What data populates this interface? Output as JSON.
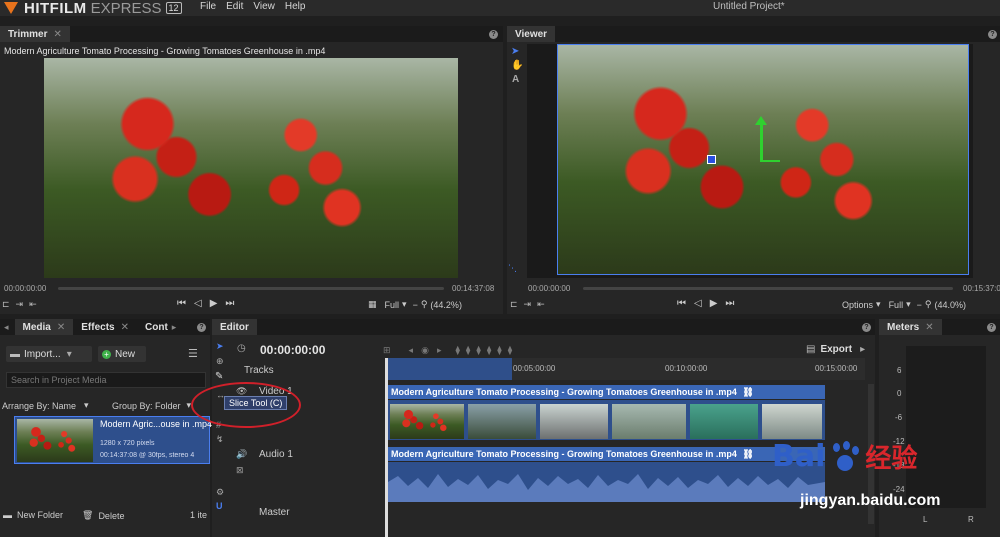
{
  "app": {
    "name_bold": "HITFILM",
    "name_light": "EXPRESS",
    "version": "12",
    "menus": [
      "File",
      "Edit",
      "View",
      "Help"
    ],
    "project_title": "Untitled Project*"
  },
  "trimmer": {
    "tab": "Trimmer",
    "clip_title": "Modern Agriculture Tomato Processing - Growing Tomatoes Greenhouse in .mp4",
    "time_start": "00:00:00:00",
    "time_end": "00:14:37:08",
    "quality": "Full",
    "zoom": "(44.2%)"
  },
  "viewer": {
    "tab": "Viewer",
    "time_start": "00:00:00:00",
    "time_end": "00:15:37:08",
    "options": "Options",
    "quality": "Full",
    "zoom": "(44.0%)"
  },
  "media": {
    "tabs": [
      "Media",
      "Effects",
      "Cont"
    ],
    "import_label": "Import...",
    "new_label": "New",
    "search_placeholder": "Search in Project Media",
    "arrange_label": "Arrange By: Name",
    "group_label": "Group By: Folder",
    "item_name": "Modern Agric...ouse in .mp4",
    "item_res": "1280 x 720 pixels",
    "item_meta": "00:14:37:08 @ 30fps, stereo 4",
    "new_folder": "New Folder",
    "delete": "Delete",
    "count": "1 ite"
  },
  "editor": {
    "tab": "Editor",
    "timecode": "00:00:00:00",
    "export": "Export",
    "tracks_label": "Tracks",
    "video_track": "Video 1",
    "audio_track": "Audio 1",
    "master": "Master",
    "ruler": [
      "00:05:00:00",
      "00:10:00:00",
      "00:15:00:00"
    ],
    "video_clip": "Modern Agriculture Tomato Processing - Growing Tomatoes Greenhouse in .mp4",
    "audio_clip": "Modern Agriculture Tomato Processing - Growing Tomatoes Greenhouse in .mp4",
    "tooltip": "Slice Tool (C)"
  },
  "meters": {
    "tab": "Meters",
    "scale": [
      "6",
      "0",
      "-6",
      "-12",
      "-18",
      "-24"
    ],
    "left": "L",
    "right": "R"
  },
  "watermark": {
    "brand": "Bai",
    "brand2": "经验",
    "url": "jingyan.baidu.com"
  },
  "colors": {
    "accent": "#3a66b5",
    "orange": "#e8731c",
    "highlight_circle": "#d0202a"
  }
}
